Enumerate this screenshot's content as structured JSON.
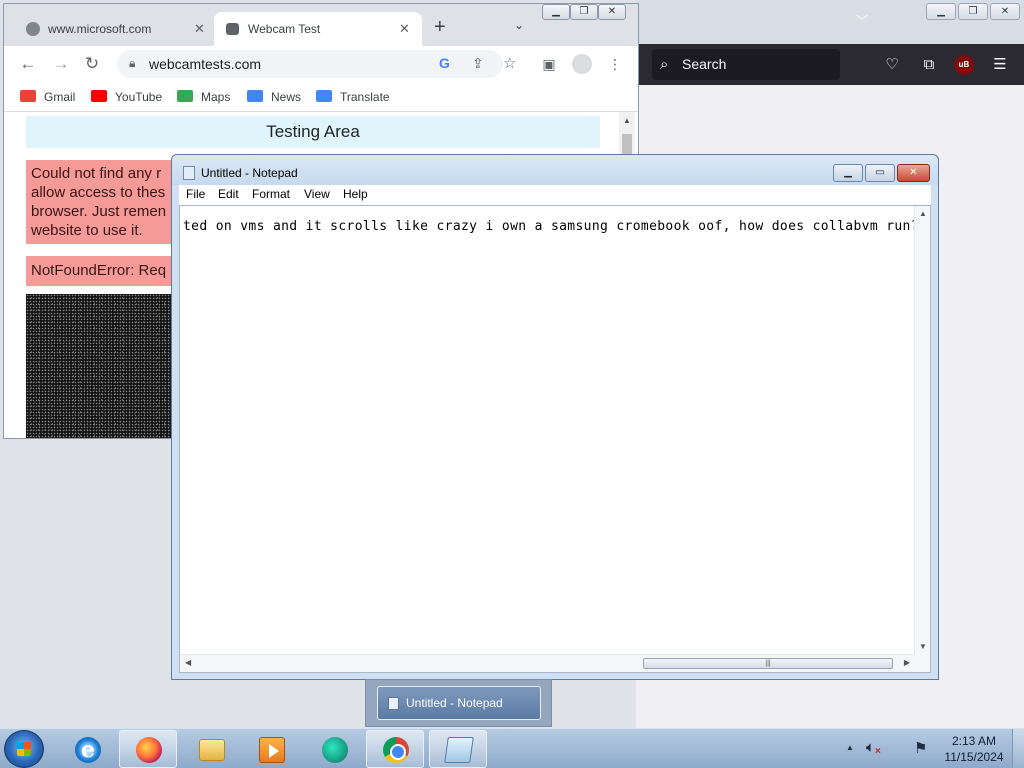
{
  "firefox": {
    "search_placeholder": "Search",
    "icons": [
      "search-icon",
      "pocket-icon",
      "extensions-icon",
      "ublock-icon",
      "menu-icon"
    ],
    "ublock_label": "uB"
  },
  "chrome": {
    "tabs": [
      {
        "label": "www.microsoft.com",
        "icon": "globe-icon",
        "active": false
      },
      {
        "label": "Webcam Test",
        "icon": "webcam-icon",
        "active": true
      }
    ],
    "address": "webcamtests.com",
    "bookmarks": [
      {
        "label": "Gmail",
        "color": "#ea4335"
      },
      {
        "label": "YouTube",
        "color": "#ff0000"
      },
      {
        "label": "Maps",
        "color": "#34a853"
      },
      {
        "label": "News",
        "color": "#4285f4"
      },
      {
        "label": "Translate",
        "color": "#4285f4"
      }
    ],
    "page": {
      "heading": "Testing Area",
      "error_message": "Could not find any r allow access to thes browser. Just remen website to use it.",
      "error_lines": [
        "Could not find any r",
        "allow access to thes",
        "browser. Just remen",
        "website to use it."
      ],
      "error_name": "NotFoundError: Req"
    }
  },
  "notepad": {
    "title": "Untitled - Notepad",
    "menu": [
      "File",
      "Edit",
      "Format",
      "View",
      "Help"
    ],
    "text": "ted on vms and it scrolls like crazy i own a samsung cromebook oof, how does collabvm run? "
  },
  "taskbar": {
    "thumbnail_label": "Untitled - Notepad",
    "pinned": [
      "internet-explorer",
      "firefox",
      "file-explorer",
      "media-player",
      "edge",
      "chrome",
      "notepad"
    ],
    "clock_time": "2:13 AM",
    "clock_date": "11/15/2024"
  },
  "colors": {
    "error_bg": "#f59b97",
    "info_bg": "#e0f4fc",
    "firefox_toolbar": "#2b2a33"
  }
}
